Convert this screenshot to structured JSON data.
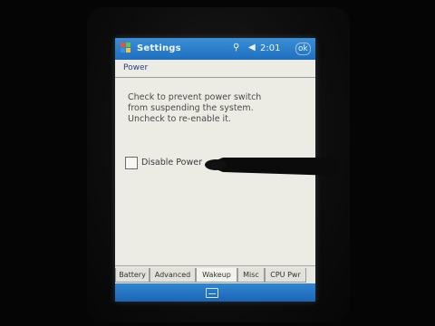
{
  "window": {
    "title": "Settings",
    "time": "2:01",
    "ok_label": "ok",
    "icons": [
      "start-flag-icon",
      "signal-icon",
      "volume-icon"
    ]
  },
  "section": {
    "header": "Power"
  },
  "description": {
    "lines": [
      "Check to prevent power switch",
      "from suspending the system.",
      "Uncheck to re-enable it."
    ]
  },
  "option": {
    "label": "Disable Power",
    "checked": false
  },
  "tabs": [
    {
      "label": "Battery",
      "active": false
    },
    {
      "label": "Advanced",
      "active": false
    },
    {
      "label": "Wakeup",
      "active": true
    },
    {
      "label": "Misc",
      "active": false
    },
    {
      "label": "CPU Pwr",
      "active": false
    }
  ],
  "menubar": {
    "icons": [
      "keyboard-icon"
    ]
  },
  "colors": {
    "titlebar": "#2a7fd0",
    "screen_bg": "#ecebe4",
    "header_text": "#2a3e8a"
  }
}
